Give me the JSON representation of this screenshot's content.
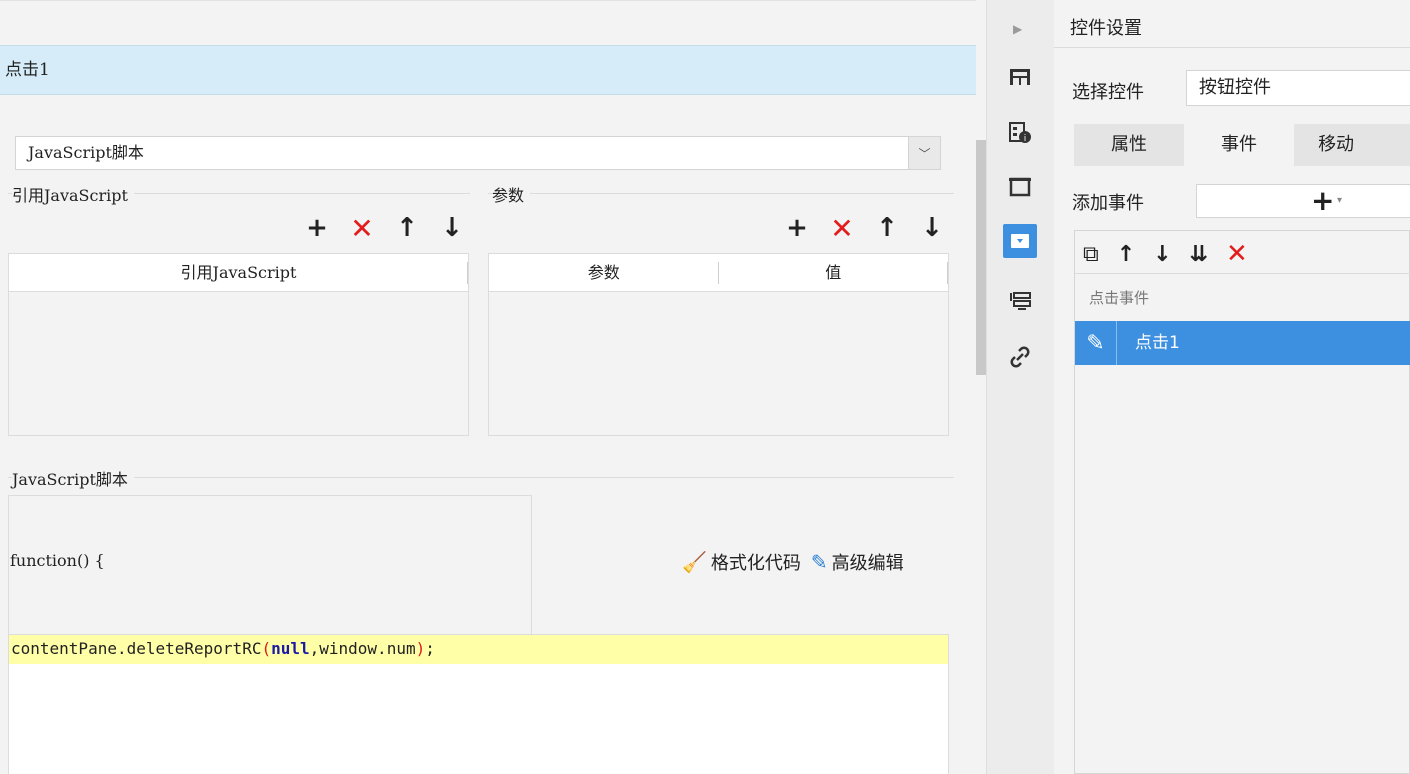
{
  "dialog": {
    "title": "点击1",
    "type_select": {
      "value": "JavaScript脚本"
    },
    "ref_js": {
      "section_label": "引用JavaScript",
      "toolbar": {
        "add": "+",
        "delete": "✕",
        "up": "↑",
        "down": "↓"
      },
      "columns": [
        "引用JavaScript"
      ]
    },
    "params": {
      "section_label": "参数",
      "toolbar": {
        "add": "+",
        "delete": "✕",
        "up": "↑",
        "down": "↓"
      },
      "columns": [
        "参数",
        "值"
      ]
    },
    "script": {
      "section_label": "JavaScript脚本",
      "function_header": "function() {",
      "code": {
        "part1": "contentPane.deleteReportRC",
        "paren_open": "(",
        "keyword": "null",
        "part2": ",window.num",
        "paren_close": ")",
        "end": ";"
      },
      "format_code_label": "格式化代码",
      "advanced_edit_label": "高级编辑"
    }
  },
  "vbar": {
    "icons": [
      "expand-arrow-icon",
      "layout-icon",
      "widget-settings-icon",
      "frame-icon",
      "button-widget-icon",
      "list-icon",
      "link-icon"
    ]
  },
  "right": {
    "title": "控件设置",
    "select_widget_label": "选择控件",
    "select_widget_value": "按钮控件",
    "tabs": [
      "属性",
      "事件",
      "移动"
    ],
    "add_event_label": "添加事件",
    "add_event_button": "+",
    "event_toolbar": {
      "copy": "⧉",
      "up": "↑",
      "down": "↓",
      "bottom": "⇊",
      "delete": "✕"
    },
    "event_group": "点击事件",
    "events": [
      {
        "label": "点击1"
      }
    ]
  }
}
